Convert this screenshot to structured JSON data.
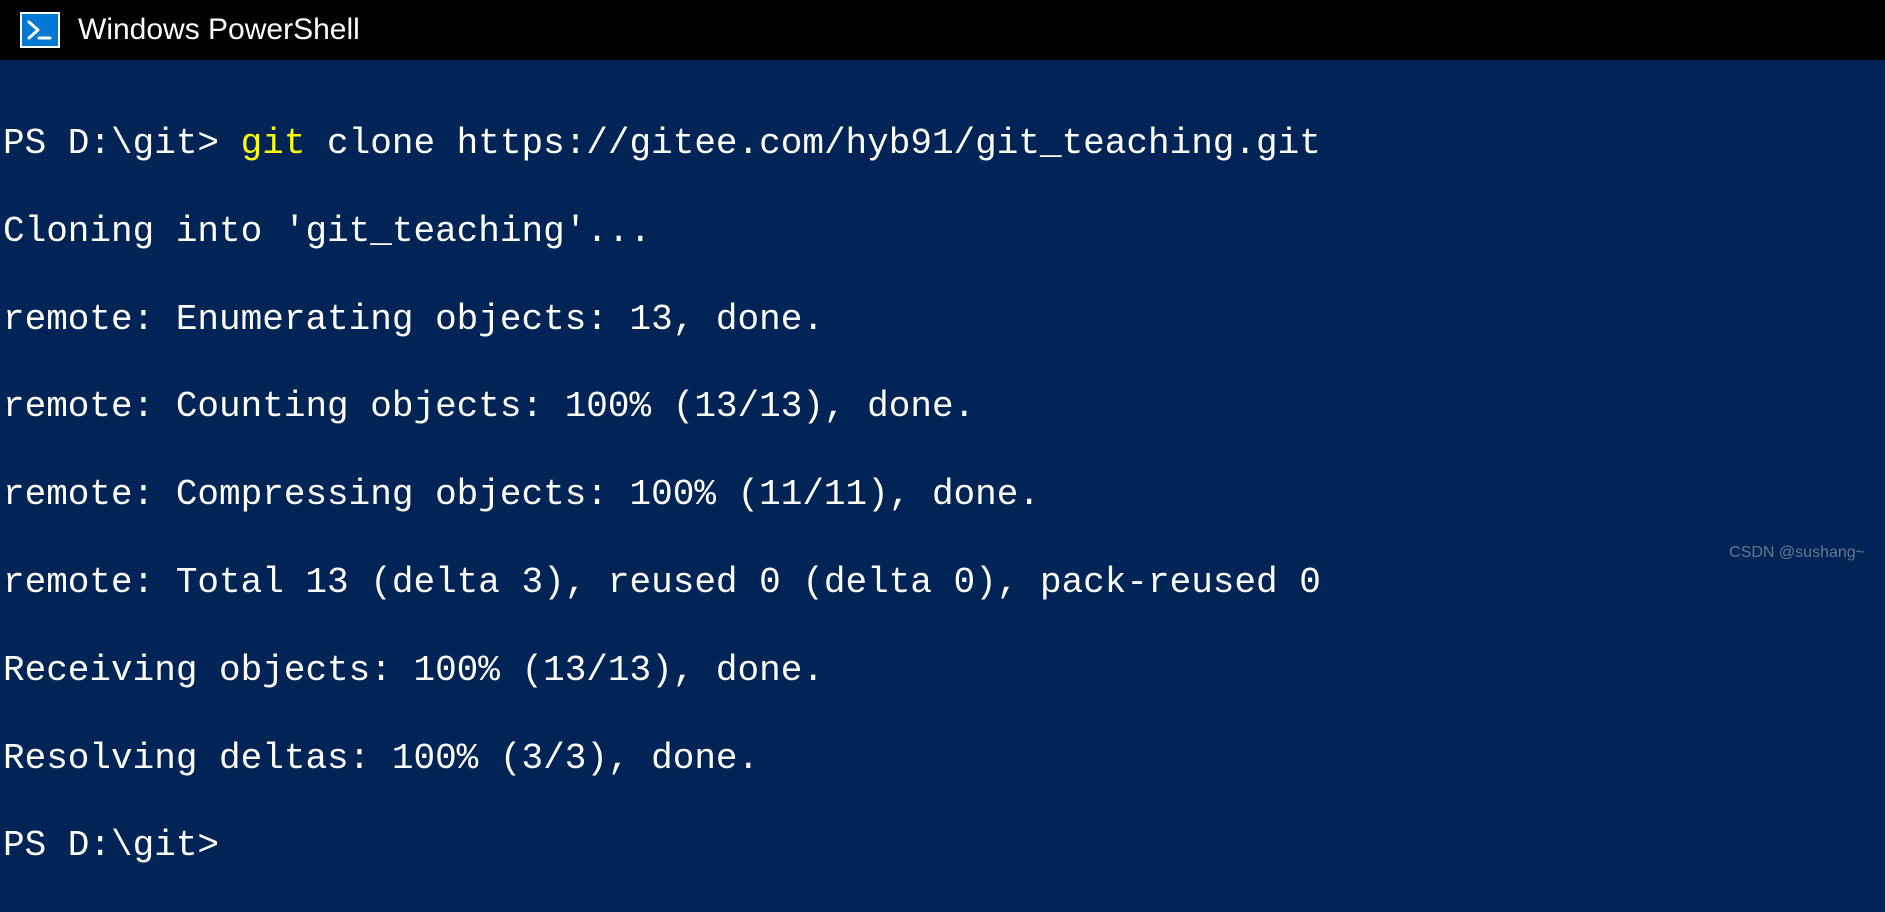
{
  "window": {
    "title": "Windows PowerShell"
  },
  "terminal": {
    "line1_prompt": "PS D:\\git> ",
    "line1_cmd": "git",
    "line1_args": " clone https://gitee.com/hyb91/git_teaching.git",
    "line2": "Cloning into 'git_teaching'...",
    "line3": "remote: Enumerating objects: 13, done.",
    "line4": "remote: Counting objects: 100% (13/13), done.",
    "line5": "remote: Compressing objects: 100% (11/11), done.",
    "line6": "remote: Total 13 (delta 3), reused 0 (delta 0), pack-reused 0",
    "line7": "Receiving objects: 100% (13/13), done.",
    "line8": "Resolving deltas: 100% (3/3), done.",
    "line9": "PS D:\\git>"
  },
  "watermark": "CSDN @sushang~"
}
